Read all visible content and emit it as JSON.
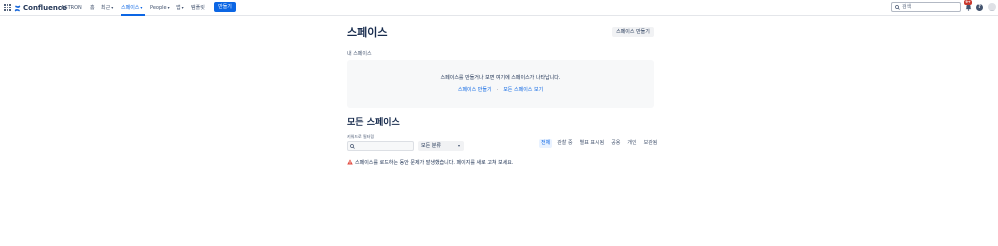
{
  "nav": {
    "product": "Confluence",
    "site": "ASTRON",
    "items": [
      {
        "label": "홈",
        "chevron": false
      },
      {
        "label": "최근",
        "chevron": true
      },
      {
        "label": "스페이스",
        "chevron": true,
        "active": true
      },
      {
        "label": "People",
        "chevron": true
      },
      {
        "label": "앱",
        "chevron": true
      },
      {
        "label": "템플릿",
        "chevron": false
      }
    ],
    "create_label": "만들기",
    "search_placeholder": "검색",
    "notification_count": "9+",
    "help_glyph": "?"
  },
  "page": {
    "title": "스페이스",
    "create_space_button": "스페이스 만들기",
    "my_spaces_label": "내 스페이스",
    "empty_message": "스페이스를 만들거나 보면 여기에 스페이스가 나타납니다.",
    "create_space_link": "스페이스 만들기",
    "separator": "·",
    "view_all_link": "모든 스페이스 보기",
    "all_spaces_title": "모든 스페이스",
    "filter_label": "키워드로 필터링",
    "category_select": "모든 분류",
    "filter_tabs": [
      "전체",
      "관찰 중",
      "별표 표시됨",
      "공용",
      "개인",
      "보관됨"
    ],
    "active_filter": "전체",
    "error_message": "스페이스를 로드하는 동안 문제가 발생했습니다. 페이지를 새로 고쳐 보세요."
  },
  "colors": {
    "accent": "#0c66e4",
    "warning": "#e2483d",
    "badge": "#c9372c"
  }
}
